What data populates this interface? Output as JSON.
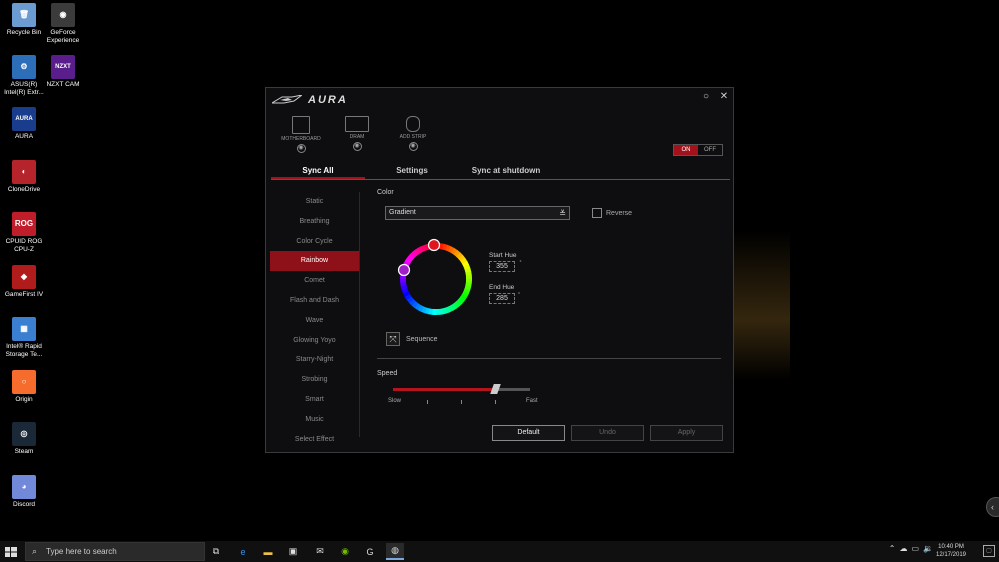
{
  "desktop": {
    "icons": [
      {
        "label": "Recycle Bin",
        "icon": "recycle-bin-icon",
        "color": "#6c9bd2",
        "glyph": "🗑"
      },
      {
        "label": "GeForce Experience",
        "icon": "geforce-icon",
        "color": "#3b3b3b",
        "glyph": "◉"
      },
      {
        "label": "ASUS(R) Intel(R) Extr...",
        "icon": "asus-icon",
        "color": "#2d6eb8",
        "glyph": "⚙"
      },
      {
        "label": "NZXT CAM",
        "icon": "nzxt-icon",
        "color": "#5a1e8c",
        "glyph": "NZXT"
      },
      {
        "label": "AURA",
        "icon": "aura-icon",
        "color": "#1a3c8c",
        "glyph": "AURA"
      },
      {
        "label": "CloneDrive",
        "icon": "clonedrive-icon",
        "color": "#b5242a",
        "glyph": "◐"
      },
      {
        "label": "CPUID ROG CPU-Z",
        "icon": "cpuz-icon",
        "color": "#c01d2b",
        "glyph": "ROG"
      },
      {
        "label": "GameFirst IV",
        "icon": "gamefirst-icon",
        "color": "#b01c1c",
        "glyph": "◆"
      },
      {
        "label": "Intel® Rapid Storage Te...",
        "icon": "intel-rst-icon",
        "color": "#3a7fd0",
        "glyph": "▦"
      },
      {
        "label": "Origin",
        "icon": "origin-icon",
        "color": "#f56c2d",
        "glyph": "○"
      },
      {
        "label": "Steam",
        "icon": "steam-icon",
        "color": "#1b2838",
        "glyph": "◎"
      },
      {
        "label": "Discord",
        "icon": "discord-icon",
        "color": "#7289da",
        "glyph": "◕"
      }
    ]
  },
  "aura": {
    "title": "AURA",
    "devices": [
      {
        "label": "MOTHERBOARD",
        "icon": "motherboard-icon"
      },
      {
        "label": "DRAM",
        "icon": "dram-icon"
      },
      {
        "label": "ADD STRIP",
        "icon": "add-strip-icon"
      }
    ],
    "toggle": {
      "on": "ON",
      "off": "OFF"
    },
    "tabs": [
      "Sync All",
      "Settings",
      "Sync at shutdown"
    ],
    "effects": [
      "Static",
      "Breathing",
      "Color Cycle",
      "Rainbow",
      "Comet",
      "Flash and Dash",
      "Wave",
      "Glowing Yoyo",
      "Starry-Night",
      "Strobing",
      "Smart",
      "Music",
      "Select Effect"
    ],
    "active_effect": "Rainbow",
    "color_label": "Color",
    "color_mode": "Gradient",
    "reverse_label": "Reverse",
    "reverse_checked": false,
    "start_hue_label": "Start Hue",
    "start_hue": "355",
    "end_hue_label": "End Hue",
    "end_hue": "285",
    "sequence_label": "Sequence",
    "speed_label": "Speed",
    "speed_level": 0.75,
    "slow_label": "Slow",
    "fast_label": "Fast",
    "buttons": {
      "default": "Default",
      "undo": "Undo",
      "apply": "Apply"
    },
    "accent": "#a3111b"
  },
  "taskbar": {
    "search_placeholder": "Type here to search",
    "time": "10:40 PM",
    "date": "12/17/2019"
  }
}
